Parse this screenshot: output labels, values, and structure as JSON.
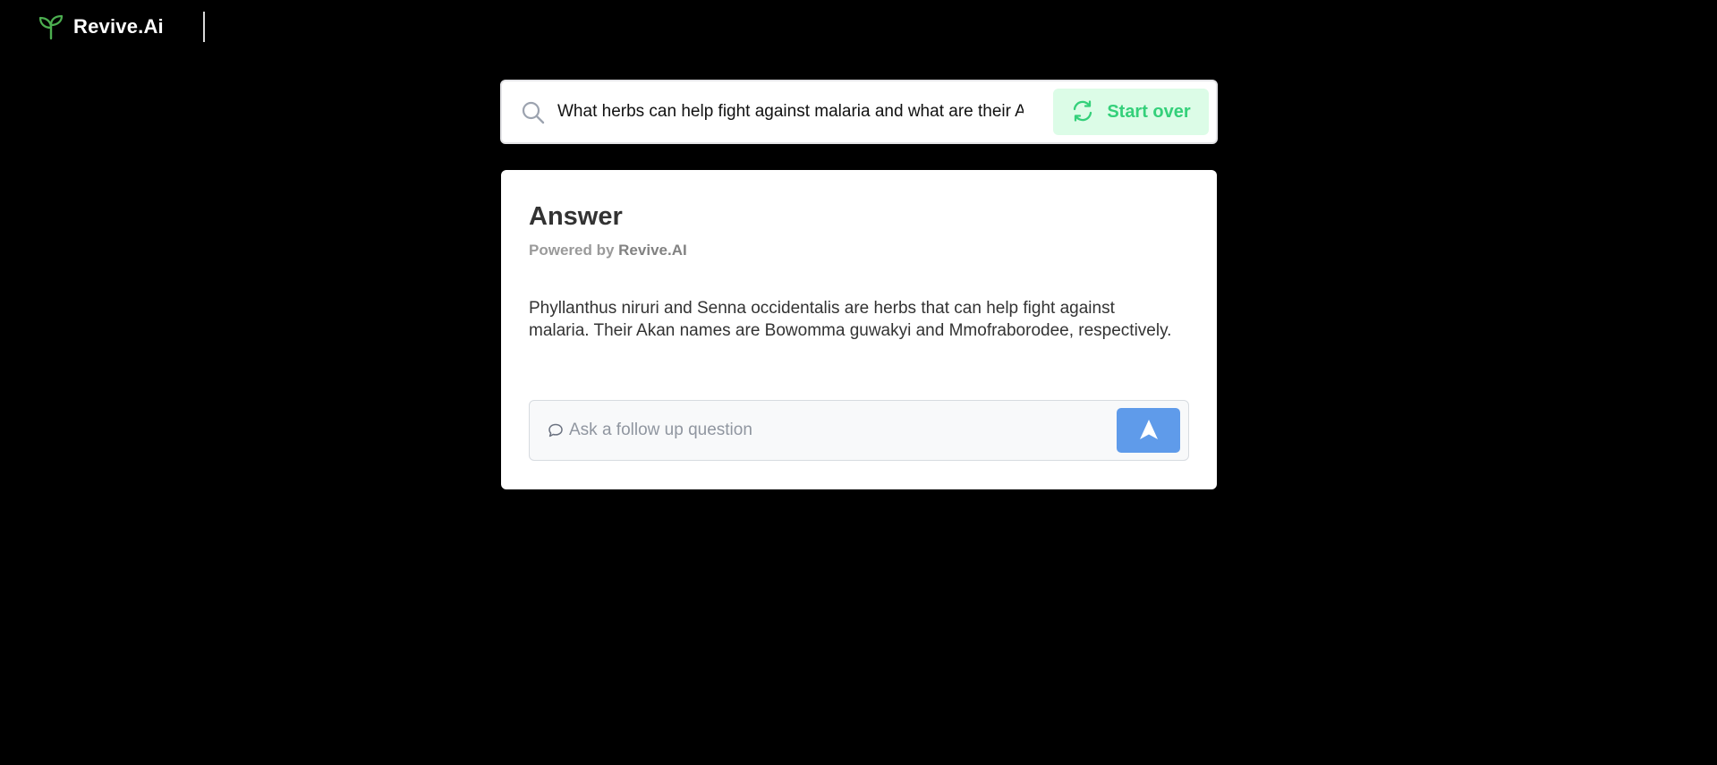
{
  "header": {
    "brand": "Revive.Ai",
    "logo_icon": "sprout-icon",
    "logo_color": "#4caf50"
  },
  "search": {
    "query": "What herbs can help fight against malaria and what are their Akan names?",
    "icon": "search-icon",
    "start_over_label": "Start over",
    "start_over_icon": "refresh-icon",
    "accent": "#34d07a"
  },
  "answer": {
    "title": "Answer",
    "powered_prefix": "Powered by",
    "powered_brand": "Revive.AI",
    "text": "Phyllanthus niruri and Senna occidentalis are herbs that can help fight against malaria. Their Akan names are Bowomma guwakyi and Mmofraborodee, respectively."
  },
  "followup": {
    "placeholder": "Ask a follow up question",
    "icon": "chat-bubble-icon",
    "send_icon": "send-arrow-icon",
    "send_color": "#5f9bea"
  }
}
